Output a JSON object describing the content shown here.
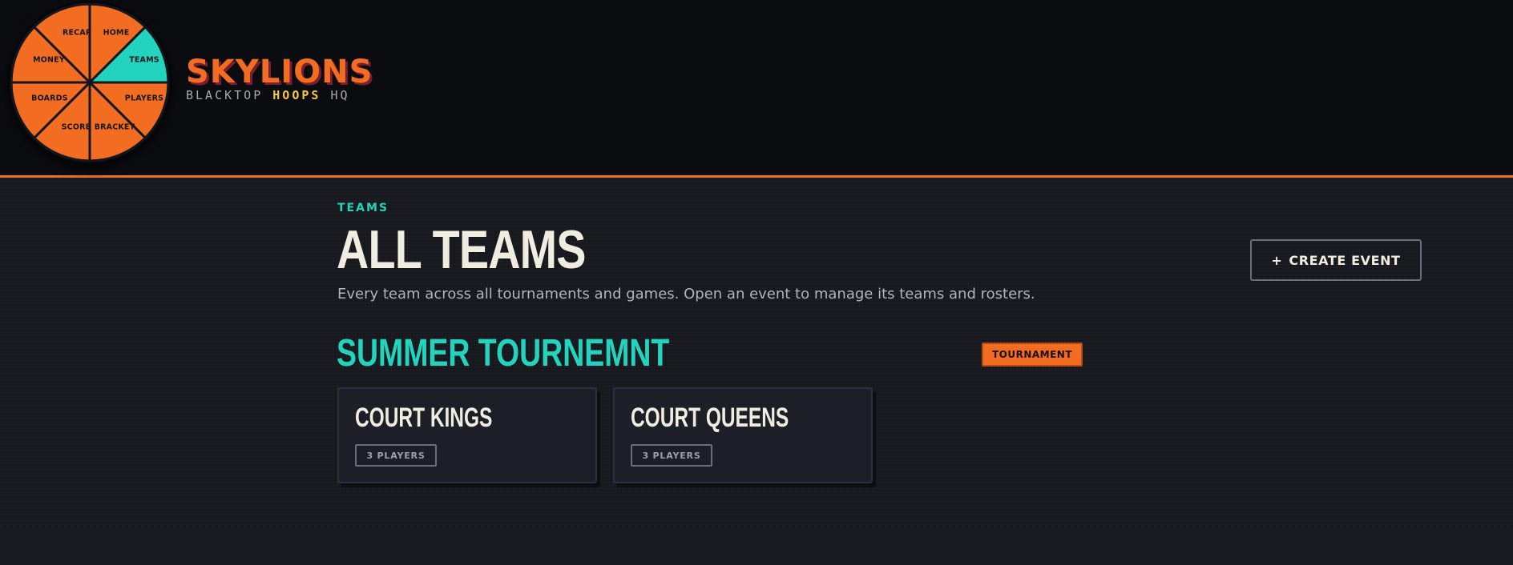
{
  "nav": {
    "items": [
      {
        "label": "HOME",
        "active": false
      },
      {
        "label": "TEAMS",
        "active": true
      },
      {
        "label": "PLAYERS",
        "active": false
      },
      {
        "label": "BRACKET",
        "active": false
      },
      {
        "label": "SCORE",
        "active": false
      },
      {
        "label": "BOARDS",
        "active": false
      },
      {
        "label": "MONEY",
        "active": false
      },
      {
        "label": "RECAP",
        "active": false
      }
    ],
    "colors": {
      "segment": "#f26d21",
      "active": "#22d4bd",
      "line": "#14161c"
    }
  },
  "brand": {
    "name": "SKYLIONS",
    "sub_prefix": "BLACKTOP",
    "sub_highlight": "HOOPS",
    "sub_suffix": "HQ"
  },
  "page": {
    "eyebrow": "TEAMS",
    "title": "ALL TEAMS",
    "description": "Every team across all tournaments and games. Open an event to manage its teams and rosters.",
    "create_button": {
      "icon": "plus-icon",
      "plus": "+",
      "label": "CREATE EVENT"
    }
  },
  "event": {
    "title": "SUMMER TOURNEMNT",
    "badge": "TOURNAMENT",
    "teams": [
      {
        "name": "COURT KINGS",
        "players": "3 PLAYERS"
      },
      {
        "name": "COURT QUEENS",
        "players": "3 PLAYERS"
      }
    ]
  },
  "theme": {
    "accent_orange": "#f26d21",
    "accent_teal": "#22d4bd",
    "accent_yellow": "#f5c842",
    "background": "#0b0c10"
  }
}
